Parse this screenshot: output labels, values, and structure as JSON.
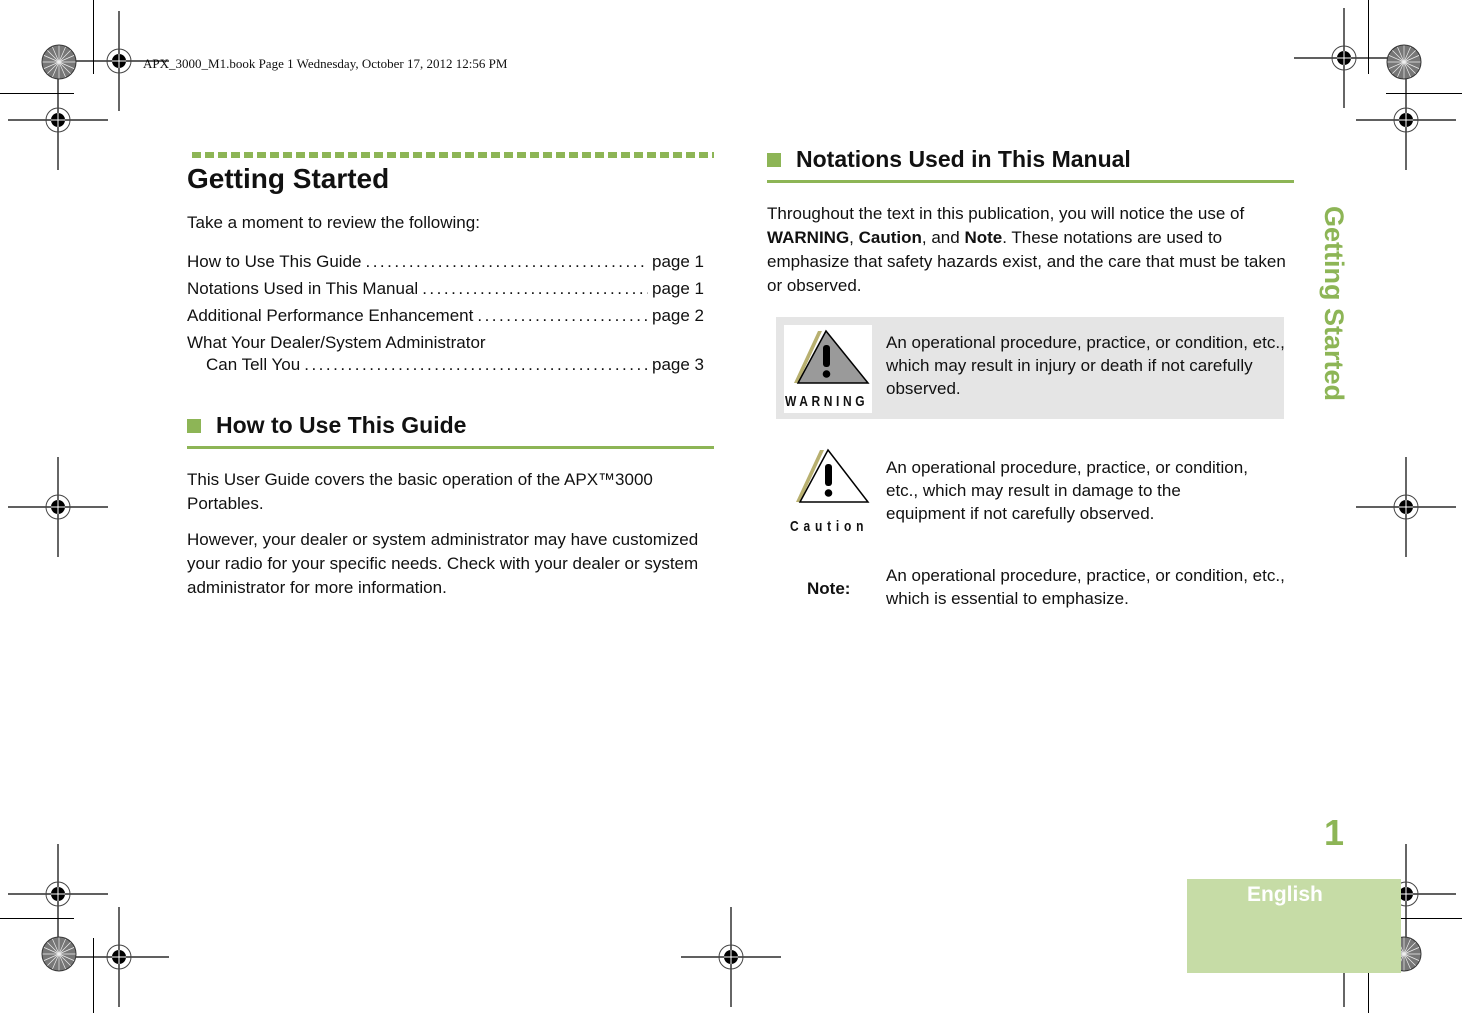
{
  "print_header": "APX_3000_M1.book  Page 1  Wednesday, October 17, 2012  12:56 PM",
  "chapter": {
    "title": "Getting Started",
    "intro": "Take a moment to review the following:",
    "toc": [
      {
        "title": "How to Use This Guide",
        "page": "page 1"
      },
      {
        "title": "Notations Used in This Manual",
        "page": "page 1"
      },
      {
        "title": "Additional Performance Enhancement",
        "page": "page 2"
      },
      {
        "title": "What Your Dealer/System Administrator",
        "title_cont": "Can Tell You",
        "page": "page 3"
      }
    ]
  },
  "how_to_use": {
    "heading": "How to Use This Guide",
    "paragraphs": [
      "This User Guide covers the basic operation of the APX™3000 Portables.",
      "However, your dealer or system administrator may have customized your radio for your specific needs. Check with your dealer or system administrator for more information."
    ]
  },
  "notations": {
    "heading": "Notations Used in This Manual",
    "intro_parts": {
      "a": "Throughout the text in this publication, you will notice the use of ",
      "warning": "WARNING",
      "b": ", ",
      "caution": "Caution",
      "c": ", and ",
      "note": "Note",
      "d": ". These notations are used to emphasize that safety hazards exist, and the care that must be taken or observed."
    },
    "items": [
      {
        "icon": "warning-triangle-icon",
        "label": "WARNING",
        "text": "An operational procedure, practice, or condition, etc., which may result in injury or death if not carefully observed."
      },
      {
        "icon": "caution-triangle-icon",
        "label": "Caution",
        "text": "An operational procedure, practice, or condition, etc., which may result in damage to the equipment if not carefully observed."
      },
      {
        "label": "Note:",
        "text": "An operational procedure, practice, or condition, etc., which is essential to emphasize."
      }
    ]
  },
  "side_tab": "Getting Started",
  "page_number": "1",
  "language": "English",
  "colors": {
    "accent": "#8db556",
    "lang_box": "#c6dca6",
    "warning_bg": "#e5e5e5"
  }
}
